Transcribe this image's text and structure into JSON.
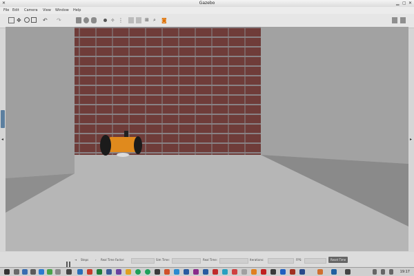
{
  "window": {
    "title": "Gazebo"
  },
  "menu": [
    "File",
    "Edit",
    "Camera",
    "View",
    "Window",
    "Help"
  ],
  "status": {
    "steps": "Steps",
    "rtf": "Real Time Factor:",
    "sim_time": "Sim Time:",
    "real_time": "Real Time:",
    "iterations": "Iterations:",
    "fps": "FPS:",
    "reset": "Reset Time"
  },
  "taskbar": {
    "clock": "19:17"
  }
}
